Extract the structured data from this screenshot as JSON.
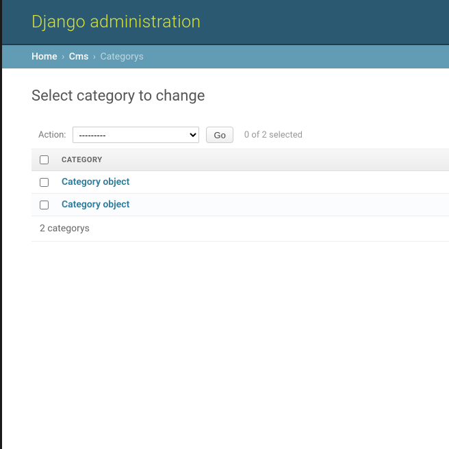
{
  "header": {
    "title": "Django administration"
  },
  "breadcrumbs": {
    "home": "Home",
    "cms": "Cms",
    "current": "Categorys",
    "sep": "›"
  },
  "page": {
    "title": "Select category to change"
  },
  "actions": {
    "label": "Action:",
    "placeholder": "---------",
    "go": "Go",
    "selection_info": "0 of 2 selected"
  },
  "table": {
    "header": "CATEGORY",
    "rows": [
      {
        "label": "Category object"
      },
      {
        "label": "Category object"
      }
    ],
    "footer": "2 categorys"
  }
}
